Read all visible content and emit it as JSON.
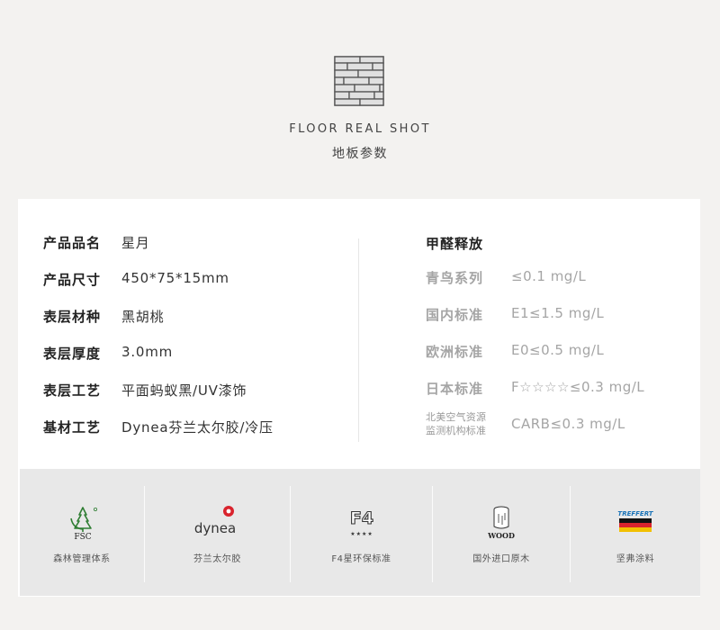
{
  "header": {
    "title_en": "FLOOR REAL SHOT",
    "title_cn": "地板参数"
  },
  "specs": [
    {
      "label": "产品品名",
      "value": "星月"
    },
    {
      "label": "产品尺寸",
      "value": "450*75*15mm"
    },
    {
      "label": "表层材种",
      "value": "黑胡桃"
    },
    {
      "label": "表层厚度",
      "value": "3.0mm"
    },
    {
      "label": "表层工艺",
      "value": "平面蚂蚁黑/UV漆饰"
    },
    {
      "label": "基材工艺",
      "value": "Dynea芬兰太尔胶/冷压"
    }
  ],
  "formaldehyde": {
    "title": "甲醛释放",
    "rows": [
      {
        "label": "青鸟系列",
        "value": "≤0.1 mg/L"
      },
      {
        "label": "国内标准",
        "value": "E1≤1.5 mg/L"
      },
      {
        "label": "欧洲标准",
        "value": "E0≤0.5 mg/L"
      },
      {
        "label": "日本标准",
        "value": "F☆☆☆☆≤0.3 mg/L"
      },
      {
        "label_line1": "北美空气资源",
        "label_line2": "监测机构标准",
        "value": "CARB≤0.3 mg/L"
      }
    ]
  },
  "certifications": [
    {
      "icon": "fsc-tree-icon",
      "logo_text": "FSC",
      "caption": "森林管理体系"
    },
    {
      "icon": "dynea-logo",
      "logo_text": "dynea",
      "caption": "芬兰太尔胶"
    },
    {
      "icon": "f4-stars-icon",
      "logo_text": "F4",
      "stars": "★★★★",
      "caption": "F4星环保标准"
    },
    {
      "icon": "wood-log-icon",
      "logo_text": "WOOD",
      "caption": "国外进口原木"
    },
    {
      "icon": "treffert-flag-logo",
      "logo_text": "TREFFERT",
      "caption": "坚弗涂料"
    }
  ],
  "colors": {
    "page_bg": "#f3f2f0",
    "card_bg": "#ffffff",
    "band_bg": "#e8e8e8",
    "label_dark": "#222222",
    "label_grey": "#a5a5a5",
    "dynea_red": "#d9232d",
    "treffert_blue": "#1a73b8"
  }
}
